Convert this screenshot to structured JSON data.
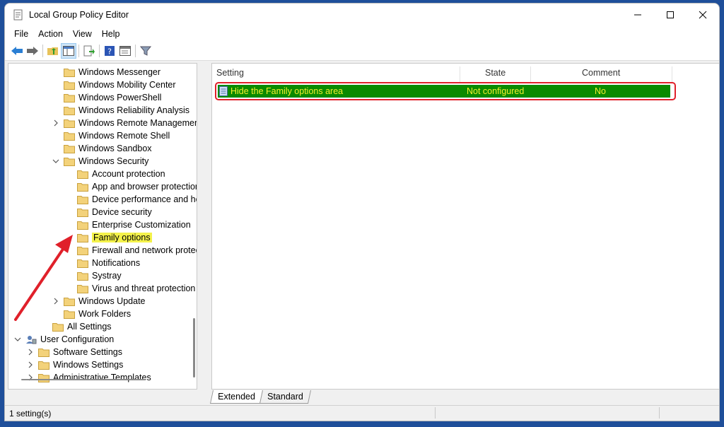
{
  "window": {
    "title": "Local Group Policy Editor"
  },
  "menu": {
    "items": [
      "File",
      "Action",
      "View",
      "Help"
    ]
  },
  "tree": {
    "items": [
      {
        "label": "Windows Messenger",
        "chev": ""
      },
      {
        "label": "Windows Mobility Center",
        "chev": ""
      },
      {
        "label": "Windows PowerShell",
        "chev": ""
      },
      {
        "label": "Windows Reliability Analysis",
        "chev": ""
      },
      {
        "label": "Windows Remote Management",
        "chev": "right"
      },
      {
        "label": "Windows Remote Shell",
        "chev": ""
      },
      {
        "label": "Windows Sandbox",
        "chev": ""
      },
      {
        "label": "Windows Security",
        "chev": "down"
      },
      {
        "label": "Account protection",
        "chev": ""
      },
      {
        "label": "App and browser protection",
        "chev": ""
      },
      {
        "label": "Device performance and he",
        "chev": ""
      },
      {
        "label": "Device security",
        "chev": ""
      },
      {
        "label": "Enterprise Customization",
        "chev": ""
      },
      {
        "label": "Family options",
        "chev": ""
      },
      {
        "label": "Firewall and network protec",
        "chev": ""
      },
      {
        "label": "Notifications",
        "chev": ""
      },
      {
        "label": "Systray",
        "chev": ""
      },
      {
        "label": "Virus and threat protection",
        "chev": ""
      },
      {
        "label": "Windows Update",
        "chev": "right"
      },
      {
        "label": "Work Folders",
        "chev": ""
      },
      {
        "label": "All Settings",
        "chev": ""
      },
      {
        "label": "User Configuration",
        "chev": "down"
      },
      {
        "label": "Software Settings",
        "chev": "right"
      },
      {
        "label": "Windows Settings",
        "chev": "right"
      },
      {
        "label": "Administrative Templates",
        "chev": "right"
      }
    ]
  },
  "list": {
    "headers": {
      "setting": "Setting",
      "state": "State",
      "comment": "Comment"
    },
    "rows": [
      {
        "setting": "Hide the Family options area",
        "state": "Not configured",
        "comment": "No"
      }
    ]
  },
  "tabs": {
    "extended": "Extended",
    "standard": "Standard"
  },
  "status": {
    "text": "1 setting(s)"
  },
  "colors": {
    "selection": "#0a8a00",
    "selection_text": "#f6ef2e",
    "highlight": "#f4f24a",
    "annotation": "#e0202a"
  }
}
